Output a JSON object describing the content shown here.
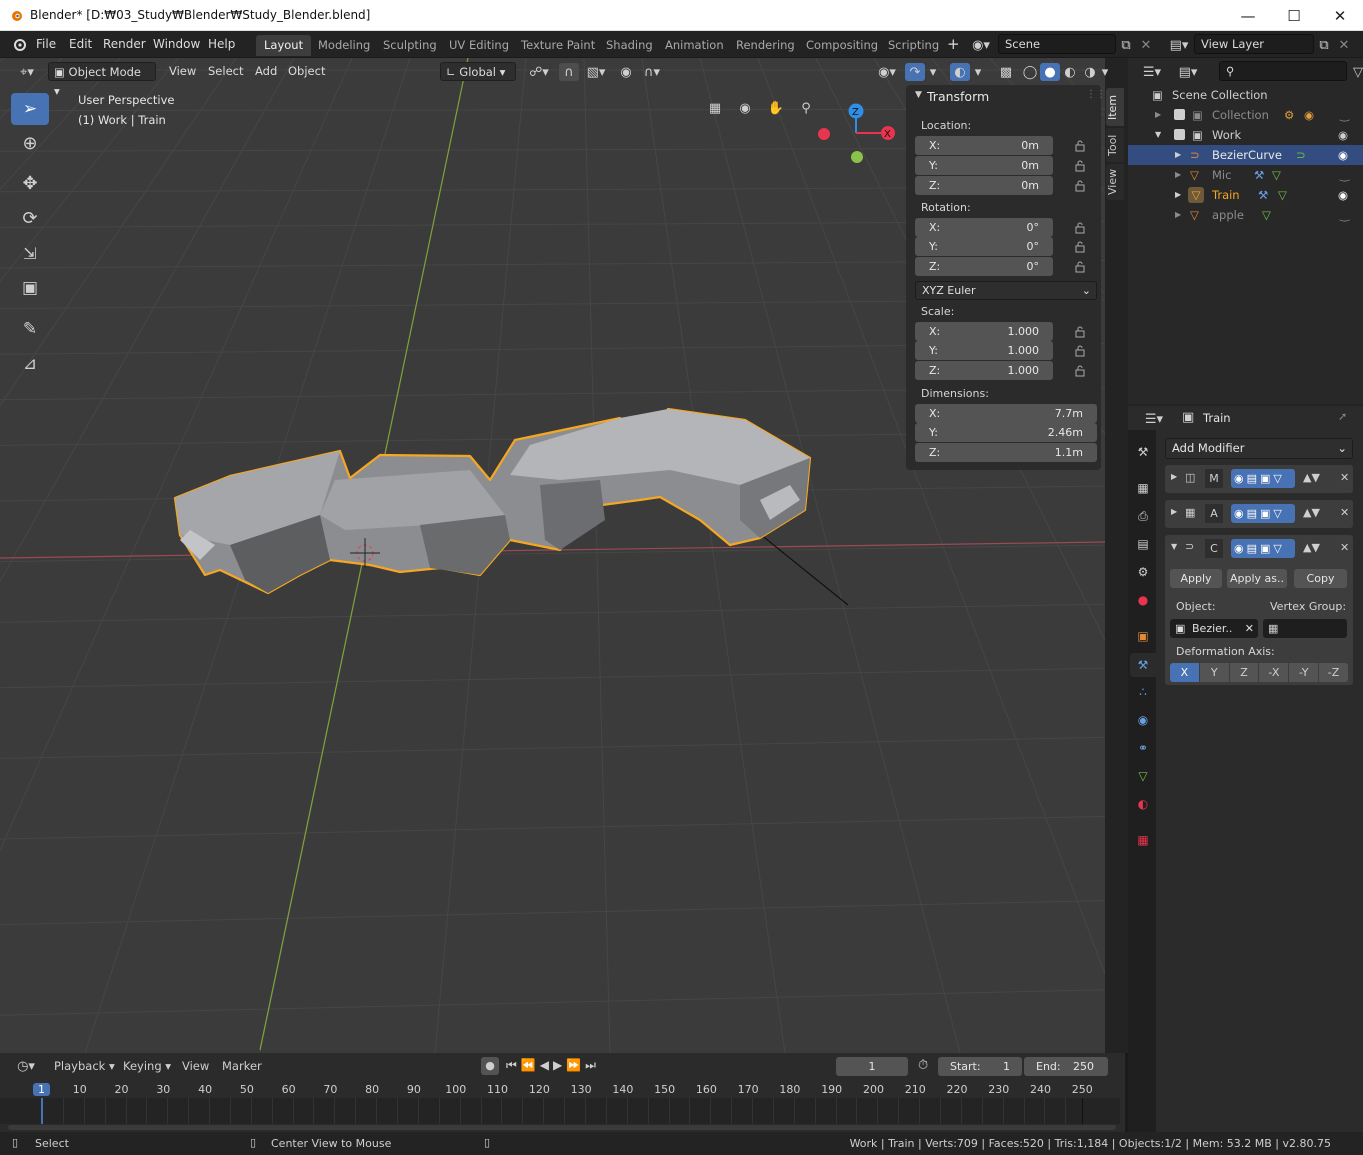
{
  "window": {
    "title": "Blender* [D:₩03_Study₩Blender₩Study_Blender.blend]"
  },
  "menus": [
    "File",
    "Edit",
    "Render",
    "Window",
    "Help"
  ],
  "workspaces": [
    "Layout",
    "Modeling",
    "Sculpting",
    "UV Editing",
    "Texture Paint",
    "Shading",
    "Animation",
    "Rendering",
    "Compositing",
    "Scripting"
  ],
  "scene": "Scene",
  "view_layer": "View Layer",
  "viewport": {
    "mode": "Object Mode",
    "menus": [
      "View",
      "Select",
      "Add",
      "Object"
    ],
    "orientation": "Global",
    "overlay_line1": "User Perspective",
    "overlay_line2": "(1) Work | Train",
    "axis": {
      "z": "Z",
      "x": "X"
    }
  },
  "npanel": {
    "title": "Transform",
    "location_label": "Location:",
    "rotation_label": "Rotation:",
    "scale_label": "Scale:",
    "dimensions_label": "Dimensions:",
    "location": [
      {
        "k": "X:",
        "v": "0m"
      },
      {
        "k": "Y:",
        "v": "0m"
      },
      {
        "k": "Z:",
        "v": "0m"
      }
    ],
    "rotation": [
      {
        "k": "X:",
        "v": "0°"
      },
      {
        "k": "Y:",
        "v": "0°"
      },
      {
        "k": "Z:",
        "v": "0°"
      }
    ],
    "rotation_mode": "XYZ Euler",
    "scale": [
      {
        "k": "X:",
        "v": "1.000"
      },
      {
        "k": "Y:",
        "v": "1.000"
      },
      {
        "k": "Z:",
        "v": "1.000"
      }
    ],
    "dimensions": [
      {
        "k": "X:",
        "v": "7.7m"
      },
      {
        "k": "Y:",
        "v": "2.46m"
      },
      {
        "k": "Z:",
        "v": "1.1m"
      }
    ],
    "tabs": [
      "Item",
      "Tool",
      "View"
    ]
  },
  "outliner": {
    "root": "Scene Collection",
    "items": [
      "Collection",
      "Work",
      "BezierCurve",
      "Mic",
      "Train",
      "apple"
    ]
  },
  "properties": {
    "object": "Train",
    "add_modifier": "Add Modifier",
    "mod_letters": [
      "M",
      "A",
      "C"
    ],
    "apply": "Apply",
    "apply_as": "Apply as..",
    "copy": "Copy",
    "object_label": "Object:",
    "vertex_group_label": "Vertex Group:",
    "object_value": "Bezier..",
    "deformation_label": "Deformation Axis:",
    "axes": [
      "X",
      "Y",
      "Z",
      "-X",
      "-Y",
      "-Z"
    ]
  },
  "timeline": {
    "menus": [
      "Playback",
      "Keying",
      "View",
      "Marker"
    ],
    "current_frame": "1",
    "start_label": "Start:",
    "start": "1",
    "end_label": "End:",
    "end": "250",
    "ticks": [
      "1",
      "10",
      "20",
      "30",
      "40",
      "50",
      "60",
      "70",
      "80",
      "90",
      "100",
      "110",
      "120",
      "130",
      "140",
      "150",
      "160",
      "170",
      "180",
      "190",
      "200",
      "210",
      "220",
      "230",
      "240",
      "250"
    ]
  },
  "status": {
    "select": "Select",
    "center": "Center View to Mouse",
    "stats": "Work | Train | Verts:709 | Faces:520 | Tris:1,184 | Objects:1/2 | Mem: 53.2 MB | v2.80.75"
  },
  "colors": {
    "accent": "#4772b3",
    "selection": "#f5a623",
    "axis_x": "#e8344f",
    "axis_y": "#8bc34a",
    "axis_z": "#2f8fe6"
  }
}
